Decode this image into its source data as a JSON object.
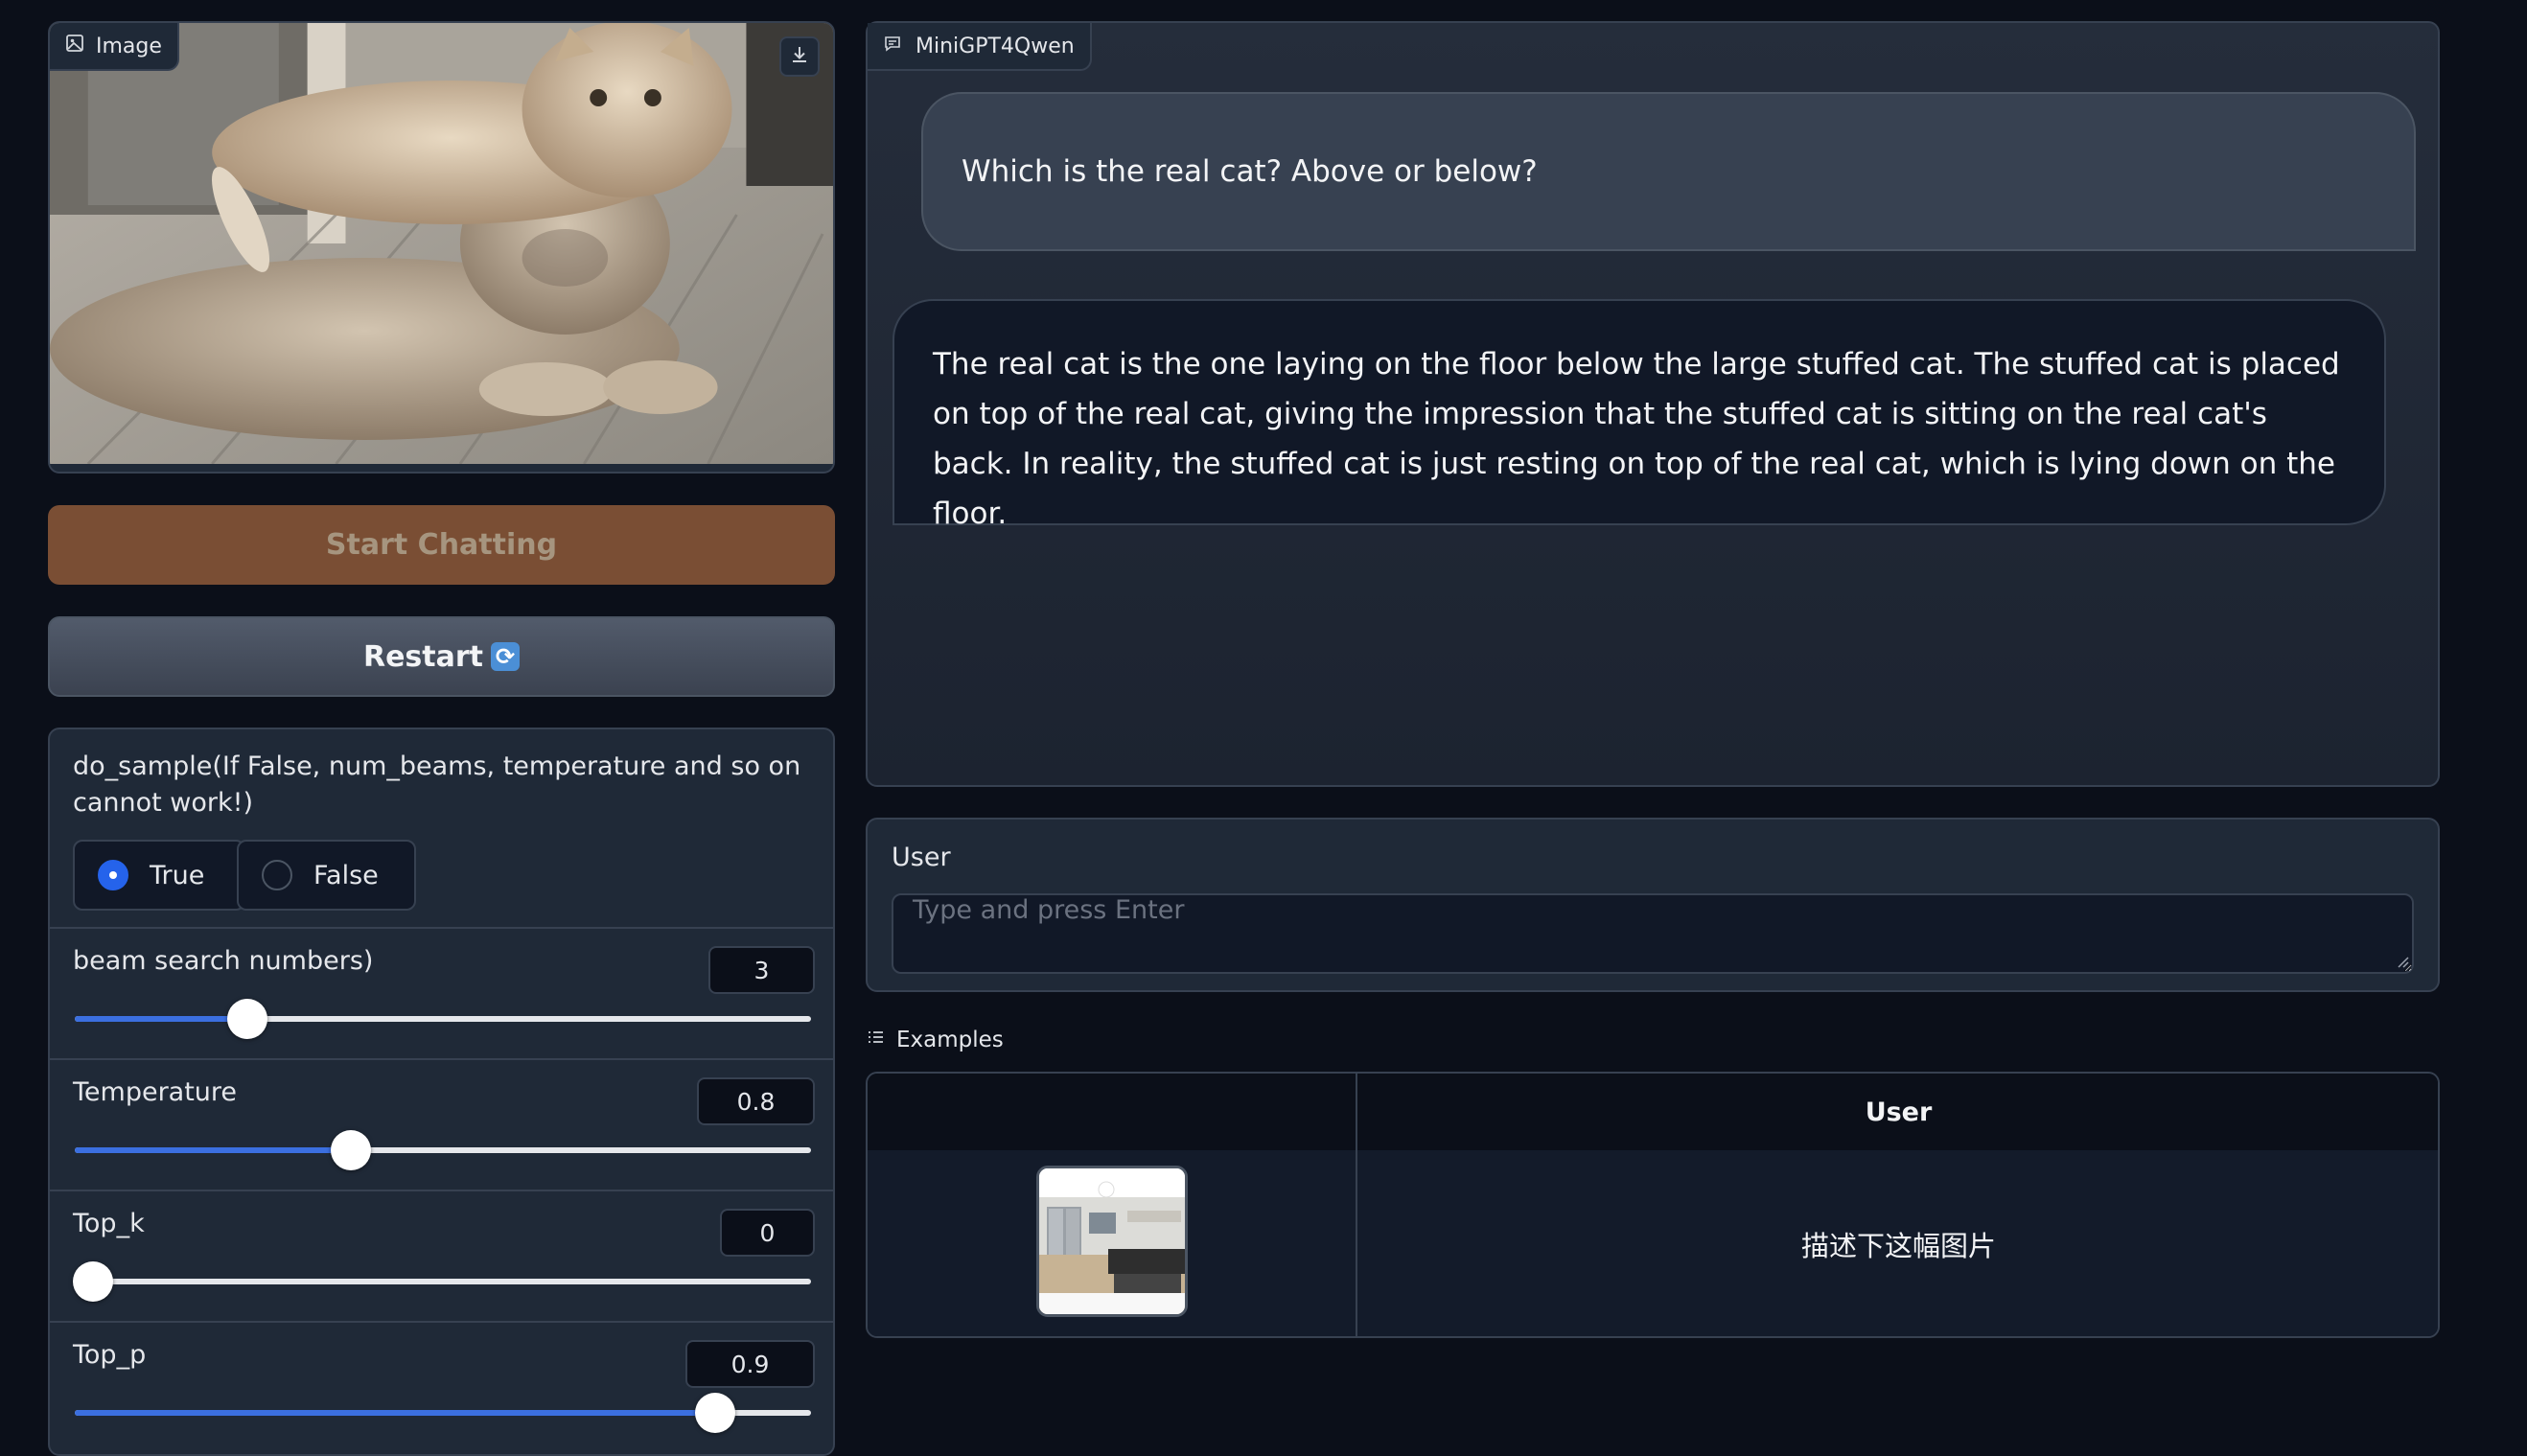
{
  "image_panel": {
    "label": "Image",
    "label_icon": "image-icon",
    "download_icon": "download-icon"
  },
  "buttons": {
    "start_chatting": "Start Chatting",
    "restart": "Restart",
    "restart_icon": "refresh-emoji-icon"
  },
  "settings": {
    "do_sample": {
      "label": "do_sample(If False, num_beams, temperature and so on cannot work!)",
      "options": [
        "True",
        "False"
      ],
      "selected": "True"
    },
    "beam": {
      "label": "beam search numbers)",
      "value": "3",
      "fraction": 0.235
    },
    "temperature": {
      "label": "Temperature",
      "value": "0.8",
      "fraction": 0.375
    },
    "top_k": {
      "label": "Top_k",
      "value": "0",
      "fraction": 0.025
    },
    "top_p": {
      "label": "Top_p",
      "value": "0.9",
      "fraction": 0.87
    }
  },
  "chatbot": {
    "label": "MiniGPT4Qwen",
    "label_icon": "chat-icon",
    "messages": [
      {
        "role": "user",
        "text": "Which is the real cat? Above or below?"
      },
      {
        "role": "bot",
        "text": "The real cat is the one laying on the floor below the large stuffed cat. The stuffed cat is placed on top of the real cat, giving the impression that the stuffed cat is sitting on the real cat's back. In reality, the stuffed cat is just resting on top of the real cat, which is lying down on the floor."
      }
    ]
  },
  "user_input": {
    "label": "User",
    "placeholder": "Type and press Enter",
    "value": ""
  },
  "examples": {
    "label": "Examples",
    "label_icon": "list-icon",
    "header_user": "User",
    "rows": [
      {
        "image": "kitchen-thumbnail",
        "text": "描述下这幅图片"
      }
    ]
  },
  "colors": {
    "background": "#0b0f19",
    "panel": "#1f2937",
    "border": "#374151",
    "start_button": "#7a4e34",
    "accent": "#3b6fe0"
  }
}
